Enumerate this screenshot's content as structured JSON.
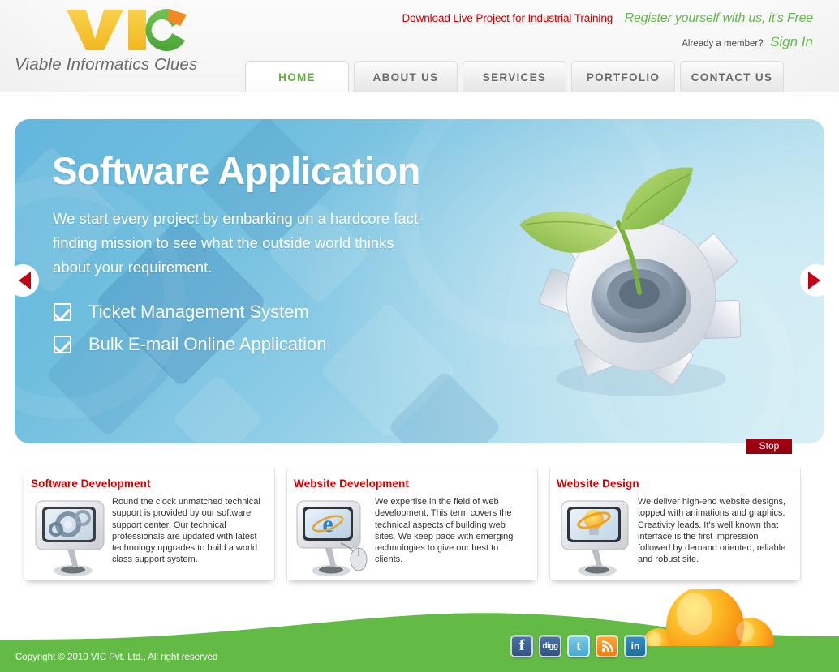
{
  "brand": {
    "logo_text": "VIC",
    "tagline": "Viable Informatics Clues",
    "colors": {
      "yellow": "#f5c43a",
      "green": "#5cb34a",
      "orange": "#f28b1e",
      "accent_green": "#63b949",
      "accent_red": "#cc0000"
    }
  },
  "toplinks": {
    "download": "Download Live Project for Industrial Training",
    "register": "Register yourself with us, it's Free",
    "member_prompt": "Already a member?",
    "signin": "Sign In"
  },
  "nav": {
    "items": [
      {
        "label": "HOME",
        "active": true
      },
      {
        "label": "ABOUT US",
        "active": false
      },
      {
        "label": "SERVICES",
        "active": false
      },
      {
        "label": "PORTFOLIO",
        "active": false
      },
      {
        "label": "CONTACT US",
        "active": false
      }
    ]
  },
  "hero": {
    "title": "Software Application",
    "subtitle": "We start every project by embarking on a hardcore fact-finding mission to see what the outside world thinks about your requirement.",
    "bullets": [
      "Ticket Management System",
      "Bulk E-mail Online Application"
    ],
    "prev_icon": "arrow-left-icon",
    "next_icon": "arrow-right-icon",
    "stop_label": "Stop",
    "illustration": "gear-with-plant-sprout"
  },
  "boxes": [
    {
      "title": "Software Development",
      "text": "Round the clock unmatched technical support is provided by our software support center. Our technical professionals are updated with latest technology upgrades to build a world class support system.",
      "icon": "monitor-gears-icon"
    },
    {
      "title": "Website Development",
      "text": "We expertise in the field of web development. This term covers the technical aspects of building web sites. We keep pace with emerging technologies to give our best to clients.",
      "icon": "monitor-browser-mouse-icon"
    },
    {
      "title": "Website Design",
      "text": "We deliver high-end website designs, topped with animations and graphics. Creativity leads. It's well known that interface is the first impression followed by demand oriented, reliable and robust site.",
      "icon": "monitor-lightbulb-icon"
    }
  ],
  "footer": {
    "copyright": "Copyright © 2010 VIC Pvt. Ltd., All right reserved",
    "background": "#63bb45",
    "social": [
      {
        "name": "facebook",
        "glyph": "f"
      },
      {
        "name": "digg",
        "glyph": "digg"
      },
      {
        "name": "twitter",
        "glyph": "t"
      },
      {
        "name": "rss",
        "glyph": ""
      },
      {
        "name": "linkedin",
        "glyph": "in"
      }
    ]
  }
}
